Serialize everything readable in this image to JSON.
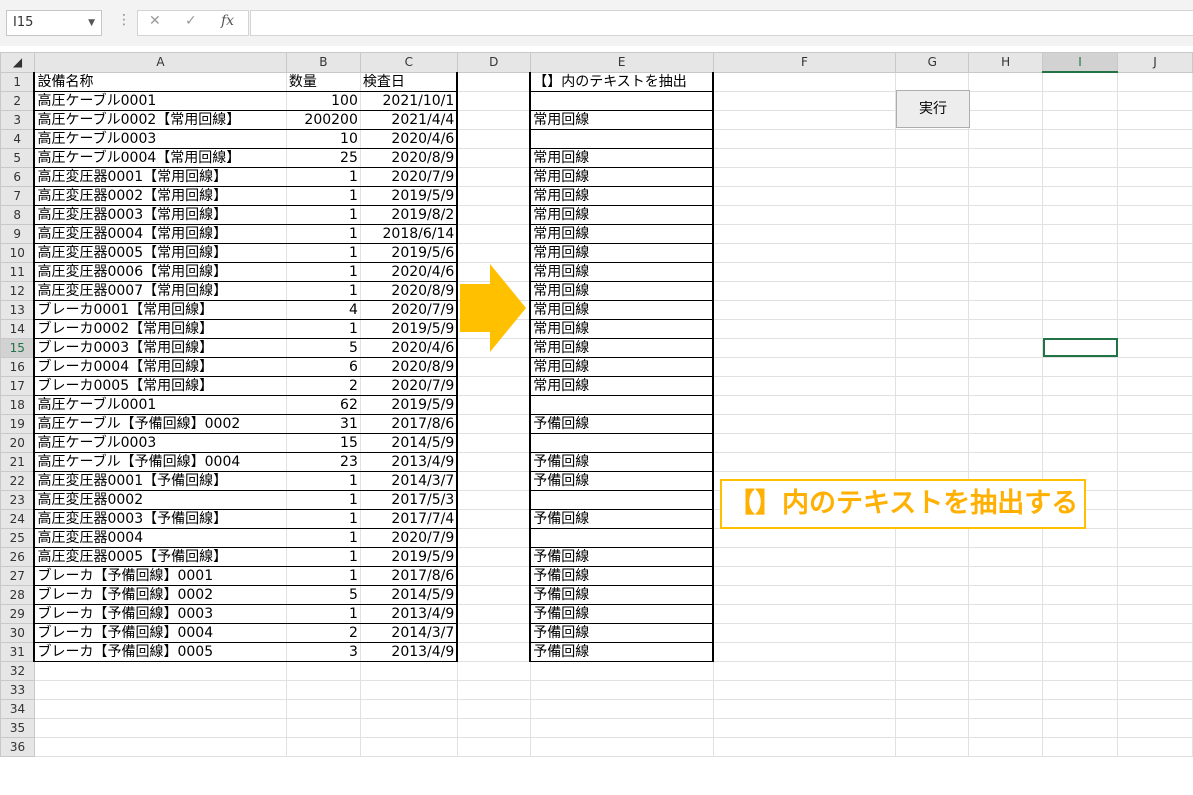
{
  "formula_bar": {
    "name_box": "I15",
    "fx_label": "fx",
    "cancel_glyph": "✕",
    "enter_glyph": "✓",
    "formula": ""
  },
  "columns": [
    "A",
    "B",
    "C",
    "D",
    "E",
    "F",
    "G",
    "H",
    "I",
    "J"
  ],
  "selected_cell": {
    "col": "I",
    "row": 15
  },
  "rows": [
    {
      "n": "1",
      "a": "設備名称",
      "b": "数量",
      "c": "検査日",
      "e": "【】内のテキストを抽出"
    },
    {
      "n": "2",
      "a": "高圧ケーブル0001",
      "b": "100",
      "c": "2021/10/1",
      "e": ""
    },
    {
      "n": "3",
      "a": "高圧ケーブル0002【常用回線】",
      "b": "200200",
      "c": "2021/4/4",
      "e": "常用回線"
    },
    {
      "n": "4",
      "a": "高圧ケーブル0003",
      "b": "10",
      "c": "2020/4/6",
      "e": ""
    },
    {
      "n": "5",
      "a": "高圧ケーブル0004【常用回線】",
      "b": "25",
      "c": "2020/8/9",
      "e": "常用回線"
    },
    {
      "n": "6",
      "a": "高圧変圧器0001【常用回線】",
      "b": "1",
      "c": "2020/7/9",
      "e": "常用回線"
    },
    {
      "n": "7",
      "a": "高圧変圧器0002【常用回線】",
      "b": "1",
      "c": "2019/5/9",
      "e": "常用回線"
    },
    {
      "n": "8",
      "a": "高圧変圧器0003【常用回線】",
      "b": "1",
      "c": "2019/8/2",
      "e": "常用回線"
    },
    {
      "n": "9",
      "a": "高圧変圧器0004【常用回線】",
      "b": "1",
      "c": "2018/6/14",
      "e": "常用回線"
    },
    {
      "n": "10",
      "a": "高圧変圧器0005【常用回線】",
      "b": "1",
      "c": "2019/5/6",
      "e": "常用回線"
    },
    {
      "n": "11",
      "a": "高圧変圧器0006【常用回線】",
      "b": "1",
      "c": "2020/4/6",
      "e": "常用回線"
    },
    {
      "n": "12",
      "a": "高圧変圧器0007【常用回線】",
      "b": "1",
      "c": "2020/8/9",
      "e": "常用回線"
    },
    {
      "n": "13",
      "a": "ブレーカ0001【常用回線】",
      "b": "4",
      "c": "2020/7/9",
      "e": "常用回線"
    },
    {
      "n": "14",
      "a": "ブレーカ0002【常用回線】",
      "b": "1",
      "c": "2019/5/9",
      "e": "常用回線"
    },
    {
      "n": "15",
      "a": "ブレーカ0003【常用回線】",
      "b": "5",
      "c": "2020/4/6",
      "e": "常用回線"
    },
    {
      "n": "16",
      "a": "ブレーカ0004【常用回線】",
      "b": "6",
      "c": "2020/8/9",
      "e": "常用回線"
    },
    {
      "n": "17",
      "a": "ブレーカ0005【常用回線】",
      "b": "2",
      "c": "2020/7/9",
      "e": "常用回線"
    },
    {
      "n": "18",
      "a": "高圧ケーブル0001",
      "b": "62",
      "c": "2019/5/9",
      "e": ""
    },
    {
      "n": "19",
      "a": "高圧ケーブル【予備回線】0002",
      "b": "31",
      "c": "2017/8/6",
      "e": "予備回線"
    },
    {
      "n": "20",
      "a": "高圧ケーブル0003",
      "b": "15",
      "c": "2014/5/9",
      "e": ""
    },
    {
      "n": "21",
      "a": "高圧ケーブル【予備回線】0004",
      "b": "23",
      "c": "2013/4/9",
      "e": "予備回線"
    },
    {
      "n": "22",
      "a": "高圧変圧器0001【予備回線】",
      "b": "1",
      "c": "2014/3/7",
      "e": "予備回線"
    },
    {
      "n": "23",
      "a": "高圧変圧器0002",
      "b": "1",
      "c": "2017/5/3",
      "e": ""
    },
    {
      "n": "24",
      "a": "高圧変圧器0003【予備回線】",
      "b": "1",
      "c": "2017/7/4",
      "e": "予備回線"
    },
    {
      "n": "25",
      "a": "高圧変圧器0004",
      "b": "1",
      "c": "2020/7/9",
      "e": ""
    },
    {
      "n": "26",
      "a": "高圧変圧器0005【予備回線】",
      "b": "1",
      "c": "2019/5/9",
      "e": "予備回線"
    },
    {
      "n": "27",
      "a": "ブレーカ【予備回線】0001",
      "b": "1",
      "c": "2017/8/6",
      "e": "予備回線"
    },
    {
      "n": "28",
      "a": "ブレーカ【予備回線】0002",
      "b": "5",
      "c": "2014/5/9",
      "e": "予備回線"
    },
    {
      "n": "29",
      "a": "ブレーカ【予備回線】0003",
      "b": "1",
      "c": "2013/4/9",
      "e": "予備回線"
    },
    {
      "n": "30",
      "a": "ブレーカ【予備回線】0004",
      "b": "2",
      "c": "2014/3/7",
      "e": "予備回線"
    },
    {
      "n": "31",
      "a": "ブレーカ【予備回線】0005",
      "b": "3",
      "c": "2013/4/9",
      "e": "予備回線"
    },
    {
      "n": "32",
      "a": "",
      "b": "",
      "c": "",
      "e": ""
    },
    {
      "n": "33",
      "a": "",
      "b": "",
      "c": "",
      "e": ""
    },
    {
      "n": "34",
      "a": "",
      "b": "",
      "c": "",
      "e": ""
    },
    {
      "n": "35",
      "a": "",
      "b": "",
      "c": "",
      "e": ""
    },
    {
      "n": "36",
      "a": "",
      "b": "",
      "c": "",
      "e": ""
    }
  ],
  "execute_button": "実行",
  "callout_text": "【】内のテキストを抽出する",
  "colors": {
    "accent": "#217346",
    "arrow": "#ffc000",
    "callout_text": "#ffb000"
  }
}
